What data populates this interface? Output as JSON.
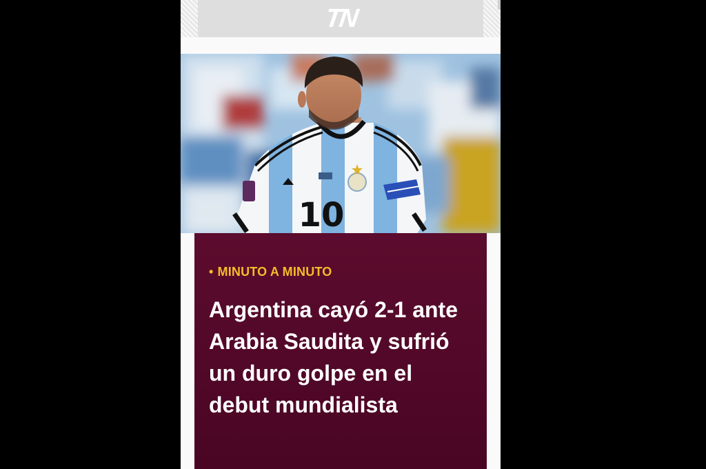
{
  "ad": {
    "logo_text": "TN"
  },
  "hero": {
    "image_label": "Jugador argentino con la camiseta número 10",
    "jersey_number": "10"
  },
  "article": {
    "kicker_dot": "•",
    "kicker": "MINUTO A MINUTO",
    "headline": "Argentina cayó 2-1 ante Arabia Saudita y sufrió un duro golpe en el debut mundialista"
  },
  "colors": {
    "card_background": "#5c0c2e",
    "kicker": "#f6bc29",
    "headline": "#ffffff",
    "page_background": "#000000"
  }
}
